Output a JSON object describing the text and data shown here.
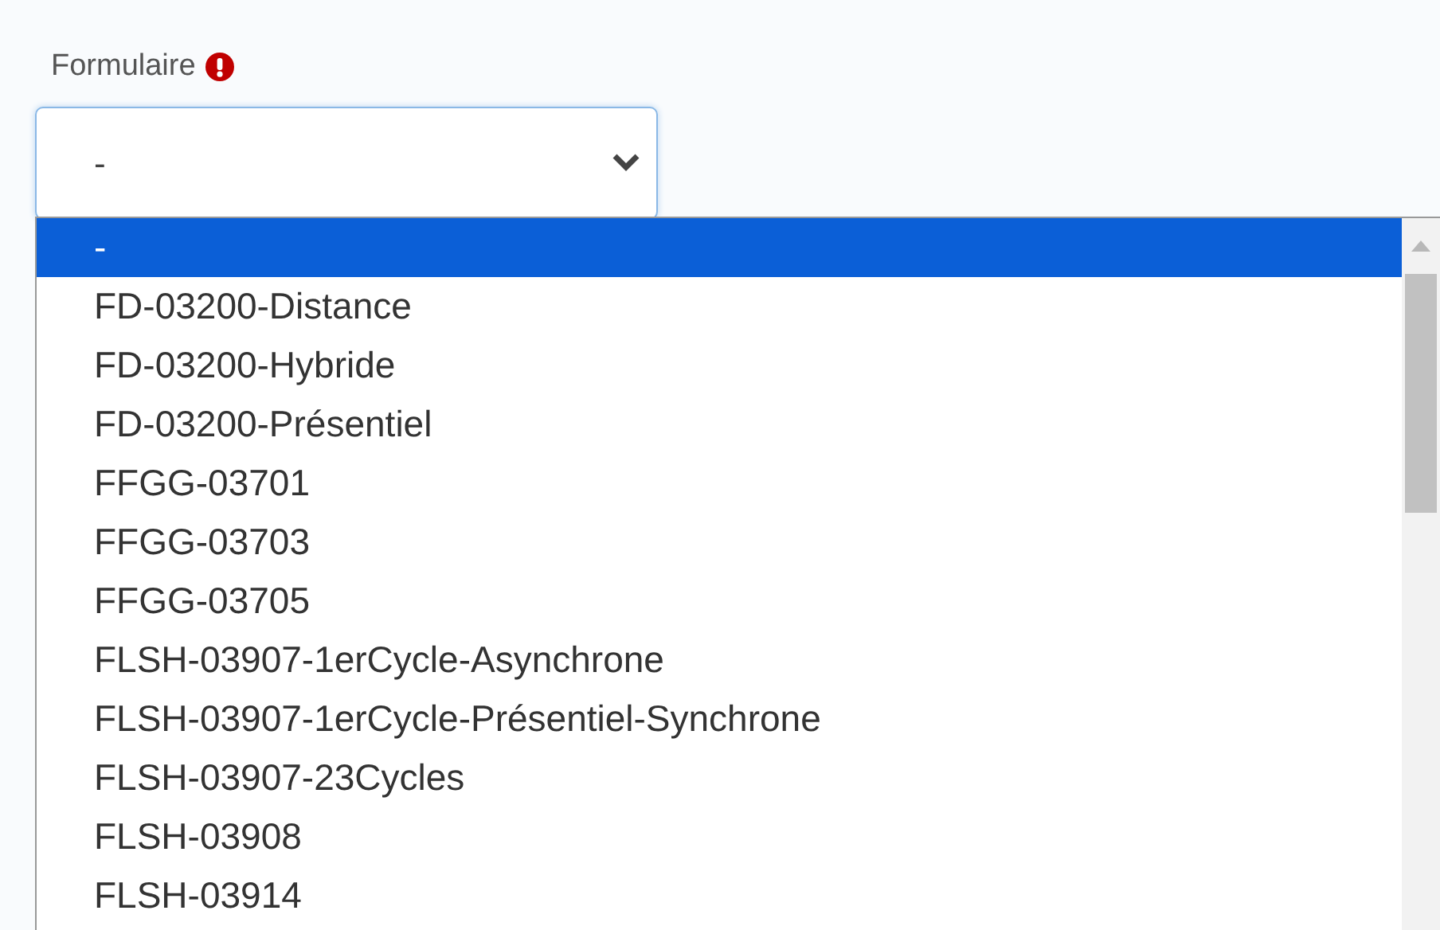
{
  "field": {
    "label": "Formulaire",
    "required": true,
    "value": "-"
  },
  "dropdown": {
    "options": [
      {
        "label": "-",
        "selected": true
      },
      {
        "label": "FD-03200-Distance",
        "selected": false
      },
      {
        "label": "FD-03200-Hybride",
        "selected": false
      },
      {
        "label": "FD-03200-Présentiel",
        "selected": false
      },
      {
        "label": "FFGG-03701",
        "selected": false
      },
      {
        "label": "FFGG-03703",
        "selected": false
      },
      {
        "label": "FFGG-03705",
        "selected": false
      },
      {
        "label": "FLSH-03907-1erCycle-Asynchrone",
        "selected": false
      },
      {
        "label": "FLSH-03907-1erCycle-Présentiel-Synchrone",
        "selected": false
      },
      {
        "label": "FLSH-03907-23Cycles",
        "selected": false
      },
      {
        "label": "FLSH-03908",
        "selected": false
      },
      {
        "label": "FLSH-03914",
        "selected": false
      }
    ]
  }
}
